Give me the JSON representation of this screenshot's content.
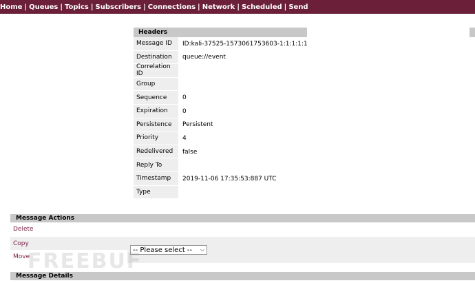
{
  "nav": {
    "items": [
      "Home",
      "Queues",
      "Topics",
      "Subscribers",
      "Connections",
      "Network",
      "Scheduled",
      "Send"
    ],
    "separator": "|"
  },
  "headers": {
    "title": "Headers",
    "rows": [
      {
        "label": "Message ID",
        "value": "ID:kali-37525-1573061753603-1:1:1:1:1"
      },
      {
        "label": "Destination",
        "value": "queue://event"
      },
      {
        "label": "Correlation ID",
        "value": ""
      },
      {
        "label": "Group",
        "value": ""
      },
      {
        "label": "Sequence",
        "value": "0"
      },
      {
        "label": "Expiration",
        "value": "0"
      },
      {
        "label": "Persistence",
        "value": "Persistent"
      },
      {
        "label": "Priority",
        "value": "4"
      },
      {
        "label": "Redelivered",
        "value": "false"
      },
      {
        "label": "Reply To",
        "value": ""
      },
      {
        "label": "Timestamp",
        "value": "2019-11-06 17:35:53:887 UTC"
      },
      {
        "label": "Type",
        "value": ""
      }
    ]
  },
  "actions": {
    "title": "Message Actions",
    "delete_label": "Delete",
    "copy_label": "Copy",
    "move_label": "Move",
    "select_value": "-- Please select --"
  },
  "details": {
    "title": "Message Details"
  },
  "watermark": "FREEBUF",
  "colors": {
    "nav_bg": "#6b1f38",
    "header_bar": "#c8c8c8",
    "label_bg": "#eeeeee",
    "link": "#7a2248"
  }
}
